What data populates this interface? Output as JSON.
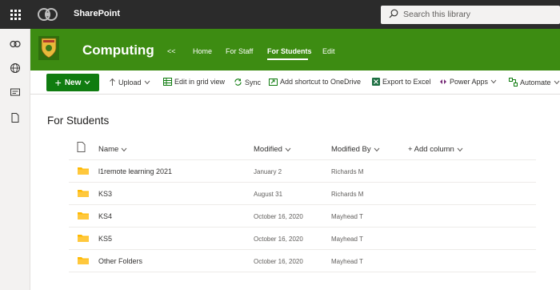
{
  "suite": {
    "app_name": "SharePoint",
    "search_placeholder": "Search this library"
  },
  "site": {
    "title": "Computing",
    "nav": [
      {
        "label": "<<"
      },
      {
        "label": "Home"
      },
      {
        "label": "For Staff"
      },
      {
        "label": "For Students"
      },
      {
        "label": "Edit"
      }
    ],
    "theme_color": "#3d8c12"
  },
  "commands": {
    "new": "New",
    "upload": "Upload",
    "edit_grid": "Edit in grid view",
    "sync": "Sync",
    "add_shortcut": "Add shortcut to OneDrive",
    "export": "Export to Excel",
    "power_apps": "Power Apps",
    "automate": "Automate"
  },
  "library": {
    "title": "For Students",
    "columns": {
      "name": "Name",
      "modified": "Modified",
      "modified_by": "Modified By",
      "add_column": "+ Add column"
    },
    "rows": [
      {
        "name": "l1remote learning 2021",
        "modified": "January 2",
        "modified_by": "Richards M"
      },
      {
        "name": "KS3",
        "modified": "August 31",
        "modified_by": "Richards M"
      },
      {
        "name": "KS4",
        "modified": "October 16, 2020",
        "modified_by": "Mayhead T"
      },
      {
        "name": "KS5",
        "modified": "October 16, 2020",
        "modified_by": "Mayhead T"
      },
      {
        "name": "Other Folders",
        "modified": "October 16, 2020",
        "modified_by": "Mayhead T"
      }
    ]
  },
  "icons": {
    "app_launcher": "waffle-icon",
    "search": "search-icon",
    "folder": "folder-icon",
    "file": "document-icon"
  },
  "colors": {
    "suitebar": "#2b2b2b",
    "new_button": "#107c10",
    "folder": "#ffb900"
  }
}
